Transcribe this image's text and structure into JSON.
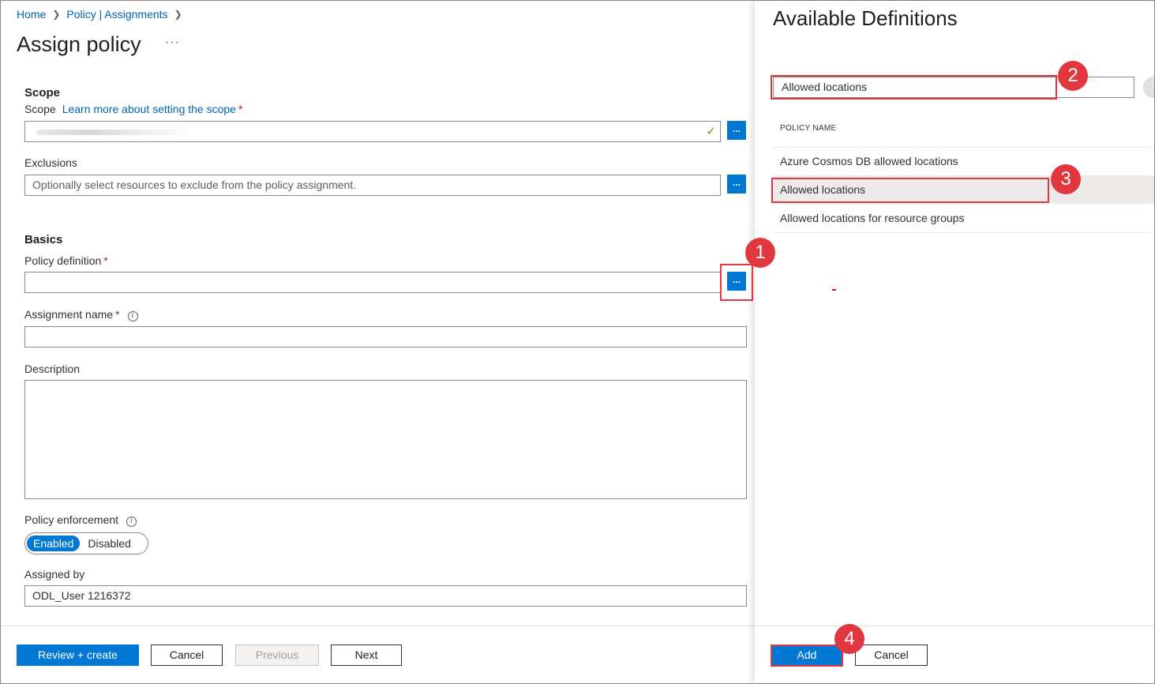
{
  "breadcrumb": {
    "home": "Home",
    "policy": "Policy | Assignments"
  },
  "page": {
    "title": "Assign policy",
    "more": "···"
  },
  "scope": {
    "heading": "Scope",
    "label": "Scope",
    "link": "Learn more about setting the scope",
    "required": "*",
    "exclusions_label": "Exclusions",
    "exclusions_placeholder": "Optionally select resources to exclude from the policy assignment.",
    "browse": "..."
  },
  "basics": {
    "heading": "Basics",
    "policy_definition_label": "Policy definition",
    "assignment_name_label": "Assignment name",
    "description_label": "Description",
    "enforcement_label": "Policy enforcement",
    "enabled": "Enabled",
    "disabled": "Disabled",
    "assigned_by_label": "Assigned by",
    "assigned_by_value": "ODL_User 1216372",
    "info_glyph": "i",
    "required": "*"
  },
  "footer": {
    "review": "Review + create",
    "cancel": "Cancel",
    "previous": "Previous",
    "next": "Next"
  },
  "panel": {
    "title": "Available Definitions",
    "search_value": "Allowed locations",
    "column_header": "POLICY NAME",
    "items": [
      "Azure Cosmos DB allowed locations",
      "Allowed locations",
      "Allowed locations for resource groups"
    ],
    "selected_index": 1,
    "add": "Add",
    "cancel": "Cancel"
  },
  "annotations": [
    "1",
    "2",
    "3",
    "4"
  ],
  "colors": {
    "accent": "#0078d4",
    "link": "#0063b1",
    "annotation": "#e0383e",
    "required": "#a4262c"
  }
}
